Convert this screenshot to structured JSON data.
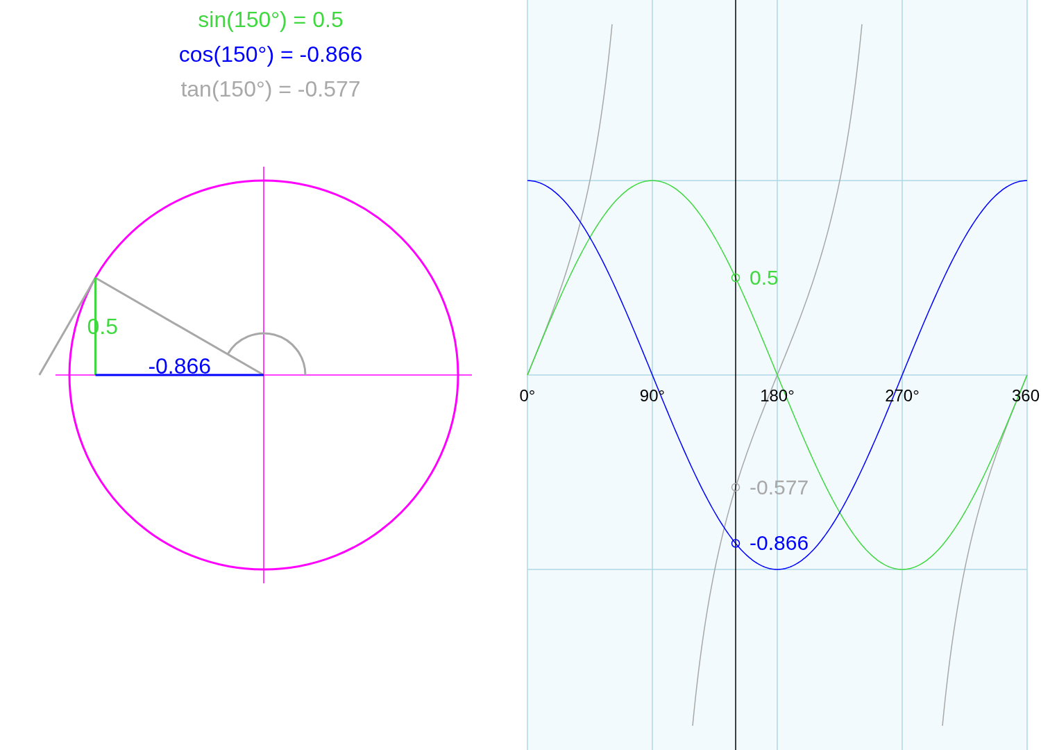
{
  "readouts": [
    {
      "text": "sin(150°) = 0.5",
      "color": "#3fd83f"
    },
    {
      "text": "cos(150°) = -0.866",
      "color": "#0000ff"
    },
    {
      "text": "tan(150°) = -0.577",
      "color": "#a8a8a8"
    }
  ],
  "circle": {
    "sine_label": "0.5",
    "cosine_label": "-0.866"
  },
  "graph": {
    "x_labels": [
      "0°",
      "90°",
      "180°",
      "270°",
      "360"
    ],
    "markers": [
      {
        "kind": "sin",
        "label": "0.5",
        "color": "#3fd83f"
      },
      {
        "kind": "tan",
        "label": "-0.577",
        "color": "#a8a8a8"
      },
      {
        "kind": "cos",
        "label": "-0.866",
        "color": "#0000ff"
      }
    ]
  }
}
